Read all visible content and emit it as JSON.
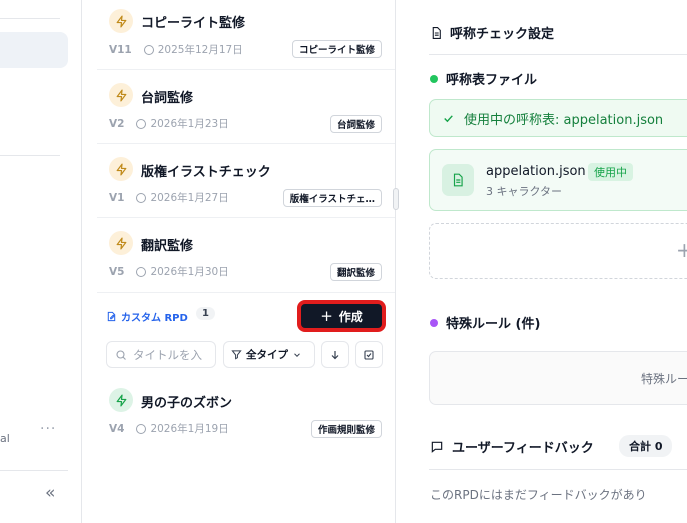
{
  "sidebar": {
    "fragment_text": "al",
    "more_label": "···",
    "collapse_label": "«"
  },
  "rpd_list": {
    "items": [
      {
        "title": "コピーライト監修",
        "version": "V11",
        "date": "2025年12月17日",
        "badge": "コピーライト監修",
        "icon_color": "#c08a1a"
      },
      {
        "title": "台詞監修",
        "version": "V2",
        "date": "2026年1月23日",
        "badge": "台詞監修",
        "icon_color": "#c08a1a"
      },
      {
        "title": "版権イラストチェック",
        "version": "V1",
        "date": "2026年1月27日",
        "badge": "版権イラストチェ…",
        "icon_color": "#c08a1a"
      },
      {
        "title": "翻訳監修",
        "version": "V5",
        "date": "2026年1月30日",
        "badge": "翻訳監修",
        "icon_color": "#c08a1a"
      }
    ],
    "custom": {
      "label": "カスタム RPD",
      "count": "1",
      "create_label": "作成",
      "search_placeholder": "タイトルを入",
      "type_filter": "全タイプ",
      "items": [
        {
          "title": "男の子のズボン",
          "version": "V4",
          "date": "2026年1月19日",
          "badge": "作画規則監修",
          "icon_color": "#16a34a"
        }
      ]
    }
  },
  "detail": {
    "section_title": "呼称チェック設定",
    "appellation": {
      "title": "呼称表ファイル",
      "dot_color": "#22c55e",
      "active_text": "使用中の呼称表: appelation.json",
      "file_name": "appelation.json",
      "file_badge": "使用中",
      "file_sub": "3 キャラクター",
      "add_symbol": "+"
    },
    "rules": {
      "title": "特殊ルール (件)",
      "dot_color": "#a855f7",
      "box_text": "特殊ルー"
    },
    "feedback": {
      "title": "ユーザーフィードバック",
      "total": "合計 0",
      "empty_text": "このRPDにはまだフィードバックがあり"
    }
  }
}
